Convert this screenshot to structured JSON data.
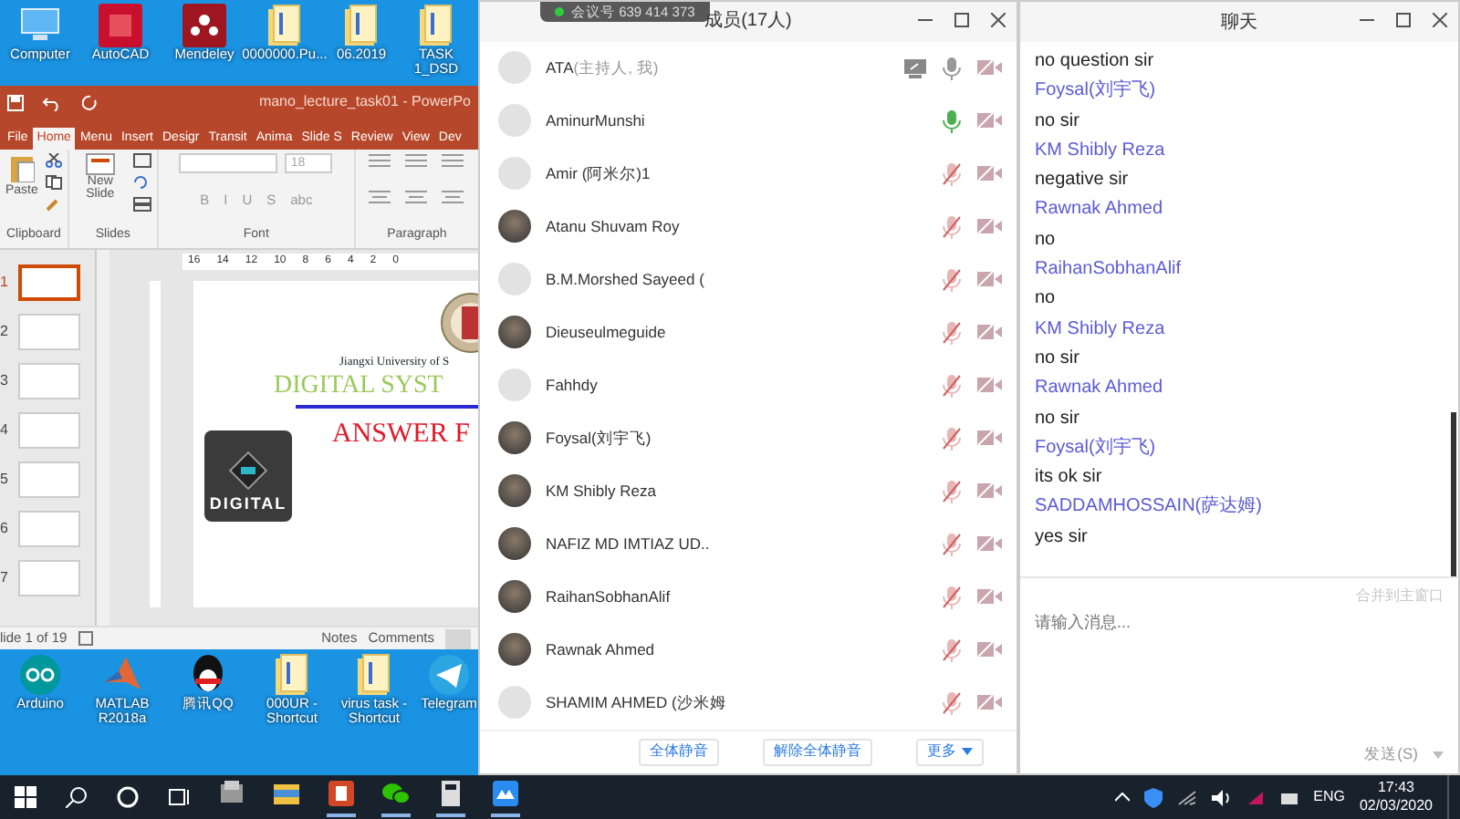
{
  "desktop": {
    "top_icons": [
      {
        "label": "Computer",
        "kind": "computer"
      },
      {
        "label": "AutoCAD",
        "kind": "autocad"
      },
      {
        "label": "Mendeley",
        "kind": "mendeley"
      },
      {
        "label": "0000000.Pu...",
        "kind": "folder"
      },
      {
        "label": "06.2019",
        "kind": "folder"
      },
      {
        "label": "TASK 1_DSD",
        "kind": "folder"
      }
    ],
    "bottom_icons": [
      {
        "label": "Arduino",
        "kind": "arduino"
      },
      {
        "label": "MATLAB R2018a",
        "kind": "matlab"
      },
      {
        "label": "腾讯QQ",
        "kind": "qq"
      },
      {
        "label": "000UR - Shortcut",
        "kind": "folder"
      },
      {
        "label": "virus task - Shortcut",
        "kind": "folder"
      },
      {
        "label": "Telegram",
        "kind": "telegram"
      }
    ]
  },
  "powerpoint": {
    "title": "mano_lecture_task01 - PowerPo",
    "tabs": [
      {
        "label": "File",
        "selected": false
      },
      {
        "label": "Home",
        "selected": true
      },
      {
        "label": "Menu",
        "selected": false
      },
      {
        "label": "Insert",
        "selected": false
      },
      {
        "label": "Desigr",
        "selected": false
      },
      {
        "label": "Transit",
        "selected": false
      },
      {
        "label": "Anima",
        "selected": false
      },
      {
        "label": "Slide S",
        "selected": false
      },
      {
        "label": "Review",
        "selected": false
      },
      {
        "label": "View",
        "selected": false
      },
      {
        "label": "Dev",
        "selected": false
      }
    ],
    "ribbon": {
      "paste": "Paste",
      "new_slide": "New Slide",
      "font_size": "18",
      "format_buttons": [
        "B",
        "I",
        "U",
        "S",
        "abc"
      ],
      "groups": [
        "Clipboard",
        "Slides",
        "Font",
        "Paragraph"
      ]
    },
    "ruler": [
      "16",
      "14",
      "12",
      "10",
      "8",
      "6",
      "4",
      "2",
      "0"
    ],
    "thumbnails": [
      {
        "number": "1",
        "selected": true
      },
      {
        "number": "2",
        "selected": false
      },
      {
        "number": "3",
        "selected": false
      },
      {
        "number": "4",
        "selected": false
      },
      {
        "number": "5",
        "selected": false
      },
      {
        "number": "6",
        "selected": false
      },
      {
        "number": "7",
        "selected": false
      }
    ],
    "slide": {
      "university": "Jiangxi University of S",
      "title": "DIGITAL SYST",
      "heading": "ANSWER F",
      "logo_text": "DIGITAL"
    },
    "status": {
      "slide_count": "lide 1 of 19",
      "notes": "Notes",
      "comments": "Comments"
    }
  },
  "members": {
    "title": "成员(17人)",
    "meeting_id": "会议号 639 414 373",
    "list": [
      {
        "name": "ATA",
        "role": "(主持人, 我)",
        "photo": false,
        "sharing": true,
        "muted": false,
        "speaking": false,
        "video_off": true
      },
      {
        "name": "AminurMunshi",
        "photo": false,
        "sharing": false,
        "muted": false,
        "speaking": true,
        "video_off": true
      },
      {
        "name": "Amir (阿米尔)1",
        "photo": false,
        "sharing": false,
        "muted": true,
        "speaking": false,
        "video_off": true
      },
      {
        "name": "Atanu Shuvam Roy",
        "photo": true,
        "sharing": false,
        "muted": true,
        "speaking": false,
        "video_off": true
      },
      {
        "name": "B.M.Morshed Sayeed (",
        "photo": false,
        "sharing": false,
        "muted": true,
        "speaking": false,
        "video_off": true
      },
      {
        "name": "Dieuseulmeguide",
        "photo": true,
        "sharing": false,
        "muted": true,
        "speaking": false,
        "video_off": true
      },
      {
        "name": "Fahhdy",
        "photo": false,
        "sharing": false,
        "muted": true,
        "speaking": false,
        "video_off": true
      },
      {
        "name": "Foysal(刘宇飞)",
        "photo": true,
        "sharing": false,
        "muted": true,
        "speaking": false,
        "video_off": true
      },
      {
        "name": "KM Shibly Reza",
        "photo": true,
        "sharing": false,
        "muted": true,
        "speaking": false,
        "video_off": true
      },
      {
        "name": "NAFIZ MD IMTIAZ UD..",
        "photo": true,
        "sharing": false,
        "muted": true,
        "speaking": false,
        "video_off": true
      },
      {
        "name": "RaihanSobhanAlif",
        "photo": true,
        "sharing": false,
        "muted": true,
        "speaking": false,
        "video_off": true
      },
      {
        "name": "Rawnak Ahmed",
        "photo": true,
        "sharing": false,
        "muted": true,
        "speaking": false,
        "video_off": true
      },
      {
        "name": "SHAMIM AHMED (沙米姆",
        "photo": false,
        "sharing": false,
        "muted": true,
        "speaking": false,
        "video_off": true
      }
    ],
    "buttons": [
      "全体静音",
      "解除全体静音",
      "更多"
    ]
  },
  "chat": {
    "title": "聊天",
    "messages": [
      {
        "kind": "message",
        "text": "no question sir"
      },
      {
        "kind": "sender",
        "text": "Foysal(刘宇飞)"
      },
      {
        "kind": "message",
        "text": "no sir"
      },
      {
        "kind": "sender",
        "text": "KM Shibly Reza"
      },
      {
        "kind": "message",
        "text": "negative sir"
      },
      {
        "kind": "sender",
        "text": "Rawnak Ahmed"
      },
      {
        "kind": "message",
        "text": "no"
      },
      {
        "kind": "sender",
        "text": "RaihanSobhanAlif"
      },
      {
        "kind": "message",
        "text": "no"
      },
      {
        "kind": "sender",
        "text": "KM Shibly Reza"
      },
      {
        "kind": "message",
        "text": "no sir"
      },
      {
        "kind": "sender",
        "text": "Rawnak Ahmed"
      },
      {
        "kind": "message",
        "text": "no sir"
      },
      {
        "kind": "sender",
        "text": "Foysal(刘宇飞)"
      },
      {
        "kind": "message",
        "text": "its ok sir"
      },
      {
        "kind": "sender",
        "text": "SADDAMHOSSAIN(萨达姆)"
      },
      {
        "kind": "message",
        "text": "yes sir"
      }
    ],
    "merge_link": "合并到主窗口",
    "placeholder": "请输入消息...",
    "send": "发送(S)"
  },
  "taskbar": {
    "apps": [
      {
        "kind": "pinned",
        "running": false
      },
      {
        "kind": "explorer",
        "running": false
      },
      {
        "kind": "powerpoint",
        "running": true
      },
      {
        "kind": "wechat",
        "running": true
      },
      {
        "kind": "calculator",
        "running": true
      },
      {
        "kind": "meeting",
        "running": true
      }
    ],
    "language": "ENG",
    "time": "17:43",
    "date": "02/03/2020"
  }
}
